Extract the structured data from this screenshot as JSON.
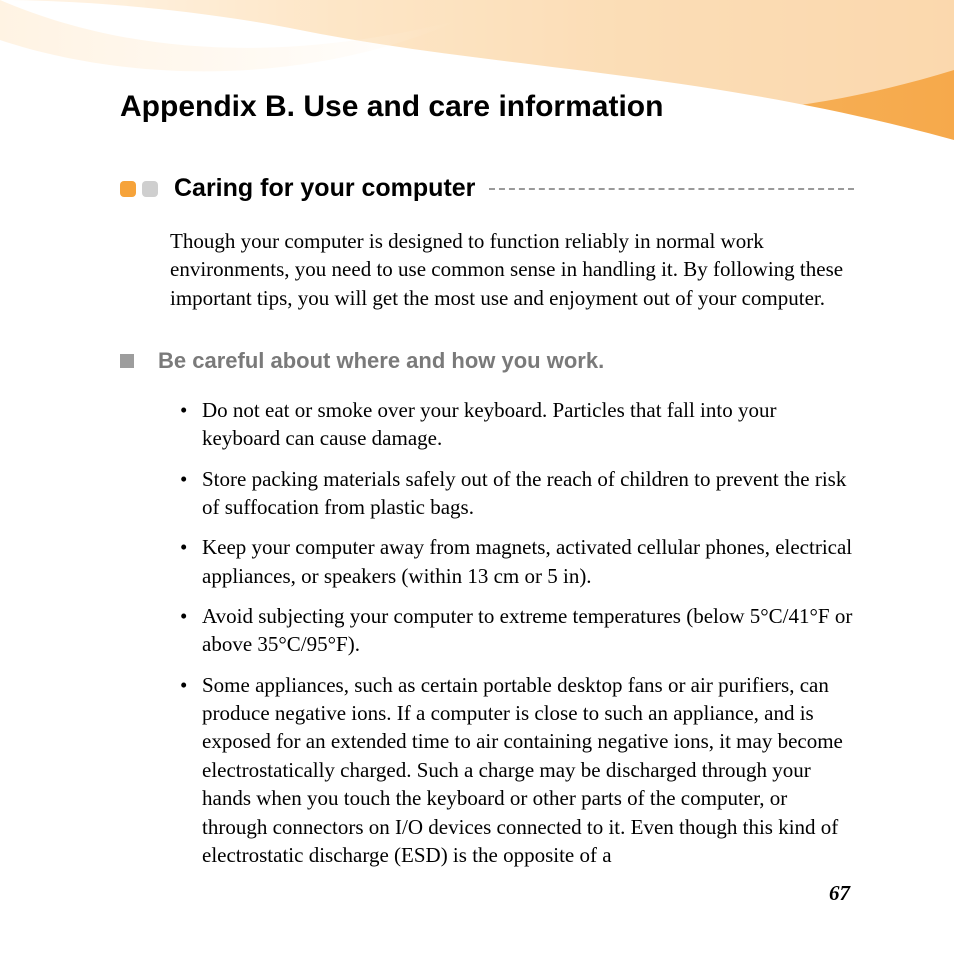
{
  "page": {
    "title": "Appendix B. Use and care information",
    "number": "67"
  },
  "section": {
    "title": "Caring for your computer",
    "intro": "Though your computer is designed to function reliably in normal work environments, you need to use common sense in handling it. By following these important tips, you will get the most use and enjoyment out of your computer."
  },
  "subsection": {
    "title": "Be careful about where and how you work.",
    "items": [
      "Do not eat or smoke over your keyboard. Particles that fall into your keyboard can cause damage.",
      "Store packing materials safely out of the reach of children to prevent the risk of suffocation from plastic bags.",
      "Keep your computer away from magnets, activated cellular phones, electrical appliances, or speakers (within 13 cm or 5 in).",
      "Avoid subjecting your computer to extreme temperatures (below 5°C/41°F or above 35°C/95°F).",
      "Some appliances, such as certain portable desktop fans or air purifiers, can produce negative ions. If a computer is close to such an appliance, and is exposed for an extended time to air containing negative ions, it may become electrostatically charged. Such a charge may be discharged through your hands when you touch the keyboard or other parts of the computer, or through connectors on I/O devices connected to it. Even though this kind of electrostatic discharge (ESD) is the opposite of a"
    ]
  }
}
